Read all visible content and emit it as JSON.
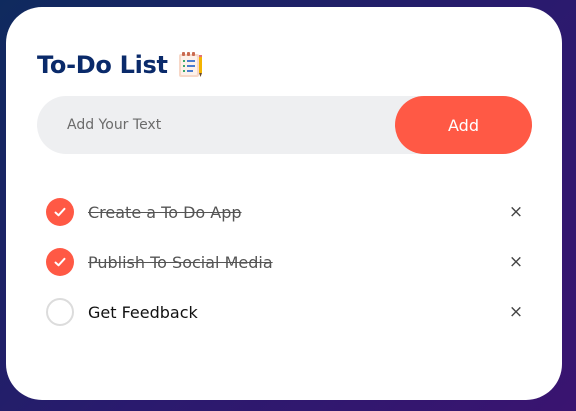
{
  "app": {
    "title": "To-Do List",
    "title_icon": "notepad-icon"
  },
  "input": {
    "placeholder": "Add Your Text",
    "value": ""
  },
  "add_button": {
    "label": "Add"
  },
  "todos": [
    {
      "text": "Create a To Do App",
      "done": true,
      "remove_label": "×"
    },
    {
      "text": "Publish To Social Media",
      "done": true,
      "remove_label": "×"
    },
    {
      "text": "Get Feedback",
      "done": false,
      "remove_label": "×"
    }
  ],
  "colors": {
    "accent": "#ff5945",
    "title": "#0a2a6a",
    "input_bg": "#eeeff1",
    "card_bg": "#ffffff"
  }
}
